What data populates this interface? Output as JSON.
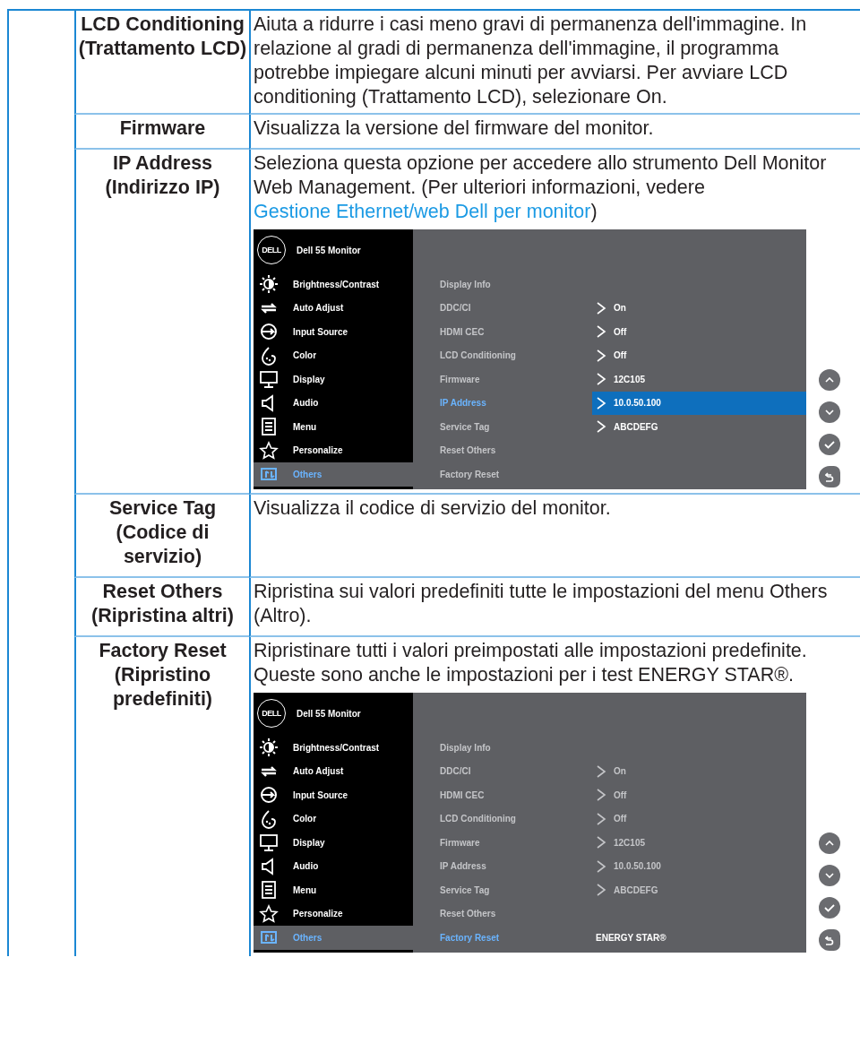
{
  "table": {
    "rows": [
      {
        "label": "LCD Conditioning (Trattamento LCD)",
        "description": "Aiuta a ridurre i casi meno gravi di permanenza dell'immagine. In relazione al gradi di permanenza dell'immagine, il programma potrebbe impiegare alcuni minuti per avviarsi. Per avviare LCD conditioning (Trattamento LCD), selezionare On."
      },
      {
        "label": "Firmware",
        "description": "Visualizza la versione del firmware del monitor."
      },
      {
        "label": "IP Address (Indirizzo IP)",
        "description": "Seleziona questa opzione per accedere allo strumento Dell Monitor Web Management. (Per ulteriori informazioni, vedere ",
        "link": "Gestione Ethernet/web Dell per monitor",
        "description_end": ")",
        "osd": {
          "logo": "DELL",
          "title": "Dell 55 Monitor",
          "values_dimmed": false,
          "menu": [
            {
              "label": "Brightness/Contrast",
              "selected": false
            },
            {
              "label": "Auto Adjust",
              "selected": false
            },
            {
              "label": "Input Source",
              "selected": false
            },
            {
              "label": "Color",
              "selected": false
            },
            {
              "label": "Display",
              "selected": false
            },
            {
              "label": "Audio",
              "selected": false
            },
            {
              "label": "Menu",
              "selected": false
            },
            {
              "label": "Personalize",
              "selected": false
            },
            {
              "label": "Others",
              "selected": true
            }
          ],
          "items": [
            {
              "label": "Display Info",
              "selected": false
            },
            {
              "label": "DDC/CI",
              "value": "On",
              "kind": "option",
              "selected": false
            },
            {
              "label": "HDMI CEC",
              "value": "Off",
              "kind": "option",
              "selected": false
            },
            {
              "label": "LCD Conditioning",
              "value": "Off",
              "kind": "option",
              "selected": false
            },
            {
              "label": "Firmware",
              "value": "12C105",
              "kind": "option",
              "selected": false
            },
            {
              "label": "IP Address",
              "value": "10.0.50.100",
              "kind": "option",
              "selected": true
            },
            {
              "label": "Service Tag",
              "value": "ABCDEFG",
              "kind": "option",
              "selected": false
            },
            {
              "label": "Reset Others",
              "selected": false
            },
            {
              "label": "Factory Reset",
              "selected": false
            }
          ]
        }
      },
      {
        "label": "Service Tag (Codice di servizio)",
        "description": "Visualizza il codice di servizio del monitor."
      },
      {
        "label": "Reset Others (Ripristina altri)",
        "description": "Ripristina sui valori predefiniti tutte le impostazioni del menu Others (Altro)."
      },
      {
        "label": "Factory Reset (Ripristino predefiniti)",
        "description": "Ripristinare tutti i valori preimpostati alle impostazioni predefinite. Queste sono anche le impostazioni per i test ENERGY STAR®.",
        "osd": {
          "logo": "DELL",
          "title": "Dell 55 Monitor",
          "values_dimmed": true,
          "menu": [
            {
              "label": "Brightness/Contrast",
              "selected": false
            },
            {
              "label": "Auto Adjust",
              "selected": false
            },
            {
              "label": "Input Source",
              "selected": false
            },
            {
              "label": "Color",
              "selected": false
            },
            {
              "label": "Display",
              "selected": false
            },
            {
              "label": "Audio",
              "selected": false
            },
            {
              "label": "Menu",
              "selected": false
            },
            {
              "label": "Personalize",
              "selected": false
            },
            {
              "label": "Others",
              "selected": true
            }
          ],
          "items": [
            {
              "label": "Display Info",
              "selected": false
            },
            {
              "label": "DDC/CI",
              "value": "On",
              "kind": "option",
              "selected": false
            },
            {
              "label": "HDMI CEC",
              "value": "Off",
              "kind": "option",
              "selected": false
            },
            {
              "label": "LCD Conditioning",
              "value": "Off",
              "kind": "option",
              "selected": false
            },
            {
              "label": "Firmware",
              "value": "12C105",
              "kind": "option",
              "selected": false
            },
            {
              "label": "IP Address",
              "value": "10.0.50.100",
              "kind": "option",
              "selected": false
            },
            {
              "label": "Service Tag",
              "value": "ABCDEFG",
              "kind": "option",
              "selected": false
            },
            {
              "label": "Reset Others",
              "selected": false
            },
            {
              "label": "Factory Reset",
              "value": "ENERGY STAR®",
              "kind": "info",
              "selected": true
            }
          ]
        }
      }
    ]
  }
}
